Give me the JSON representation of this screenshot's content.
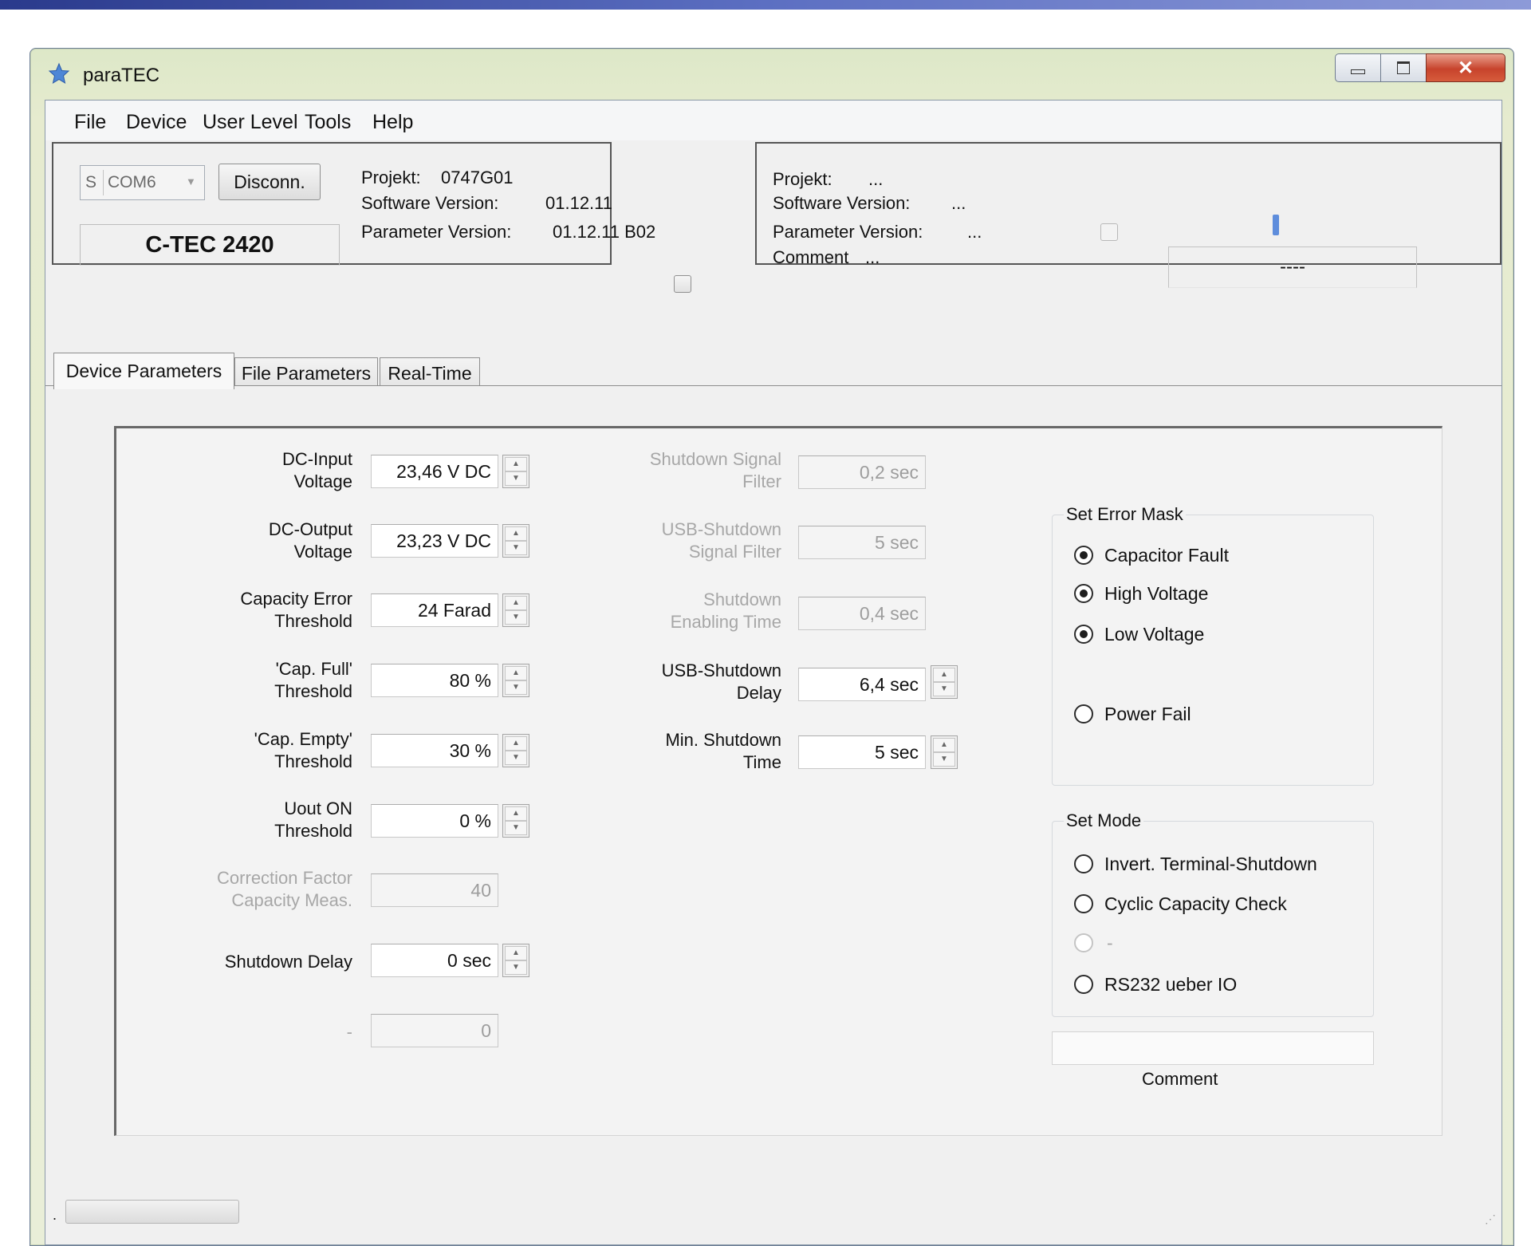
{
  "window": {
    "title": "paraTEC"
  },
  "menu": {
    "items": [
      "File",
      "Device",
      "User Level",
      "Tools",
      "Help"
    ]
  },
  "connection": {
    "port_prefix": "S",
    "port": "COM6",
    "disconnect_label": "Disconn.",
    "device_name": "C-TEC 2420"
  },
  "device_info": {
    "projekt_label": "Projekt:",
    "projekt_value": "0747G01",
    "software_label": "Software Version:",
    "software_value": "01.12.11",
    "parameter_label": "Parameter Version:",
    "parameter_value": "01.12.11 B02"
  },
  "file_info": {
    "projekt_label": "Projekt:",
    "projekt_value": "...",
    "software_label": "Software Version:",
    "software_value": "...",
    "parameter_label": "Parameter Version:",
    "parameter_value": "...",
    "comment_label": "Comment",
    "comment_value": "...",
    "status_value": "----"
  },
  "tabs": [
    "Device Parameters",
    "File Parameters",
    "Real-Time"
  ],
  "active_tab": "Device Parameters",
  "left_params": [
    {
      "line1": "DC-Input",
      "line2": "Voltage",
      "value": "23,46 V DC",
      "enabled": true,
      "spin": true
    },
    {
      "line1": "DC-Output",
      "line2": "Voltage",
      "value": "23,23 V DC",
      "enabled": true,
      "spin": true
    },
    {
      "line1": "Capacity Error",
      "line2": "Threshold",
      "value": "24 Farad",
      "enabled": true,
      "spin": true
    },
    {
      "line1": "'Cap. Full'",
      "line2": "Threshold",
      "value": "80 %",
      "enabled": true,
      "spin": true
    },
    {
      "line1": "'Cap. Empty'",
      "line2": "Threshold",
      "value": "30 %",
      "enabled": true,
      "spin": true
    },
    {
      "line1": "Uout ON",
      "line2": "Threshold",
      "value": "0 %",
      "enabled": true,
      "spin": true
    },
    {
      "line1": "Correction Factor",
      "line2": "Capacity Meas.",
      "value": "40",
      "enabled": false,
      "spin": false
    },
    {
      "line1": "Shutdown Delay",
      "line2": "",
      "value": "0 sec",
      "enabled": true,
      "spin": true
    },
    {
      "line1": "-",
      "line2": "",
      "value": "0",
      "enabled": false,
      "spin": false
    }
  ],
  "mid_params": [
    {
      "line1": "Shutdown Signal",
      "line2": "Filter",
      "value": "0,2 sec",
      "enabled": false,
      "spin": false
    },
    {
      "line1": "USB-Shutdown",
      "line2": "Signal Filter",
      "value": "5 sec",
      "enabled": false,
      "spin": false
    },
    {
      "line1": "Shutdown",
      "line2": "Enabling Time",
      "value": "0,4 sec",
      "enabled": false,
      "spin": false
    },
    {
      "line1": "USB-Shutdown",
      "line2": "Delay",
      "value": "6,4 sec",
      "enabled": true,
      "spin": true
    },
    {
      "line1": "Min. Shutdown",
      "line2": "Time",
      "value": "5 sec",
      "enabled": true,
      "spin": true
    }
  ],
  "error_mask": {
    "title": "Set Error Mask",
    "options": [
      {
        "label": "Capacitor Fault",
        "checked": true,
        "enabled": true
      },
      {
        "label": "High Voltage",
        "checked": true,
        "enabled": true
      },
      {
        "label": "Low Voltage",
        "checked": true,
        "enabled": true
      },
      {
        "label": "Power Fail",
        "checked": false,
        "enabled": true
      }
    ]
  },
  "mode": {
    "title": "Set Mode",
    "options": [
      {
        "label": "Invert. Terminal-Shutdown",
        "checked": false,
        "enabled": true
      },
      {
        "label": "Cyclic Capacity Check",
        "checked": false,
        "enabled": true
      },
      {
        "label": "-",
        "checked": false,
        "enabled": false
      },
      {
        "label": "RS232 ueber IO",
        "checked": false,
        "enabled": true
      }
    ]
  },
  "comment": {
    "label": "Comment",
    "value": ""
  },
  "statusbar": {
    "text": "."
  },
  "colors": {
    "accent": "#5e8ddc",
    "close_button": "#c7432c",
    "disabled_text": "#a7a7a7"
  }
}
